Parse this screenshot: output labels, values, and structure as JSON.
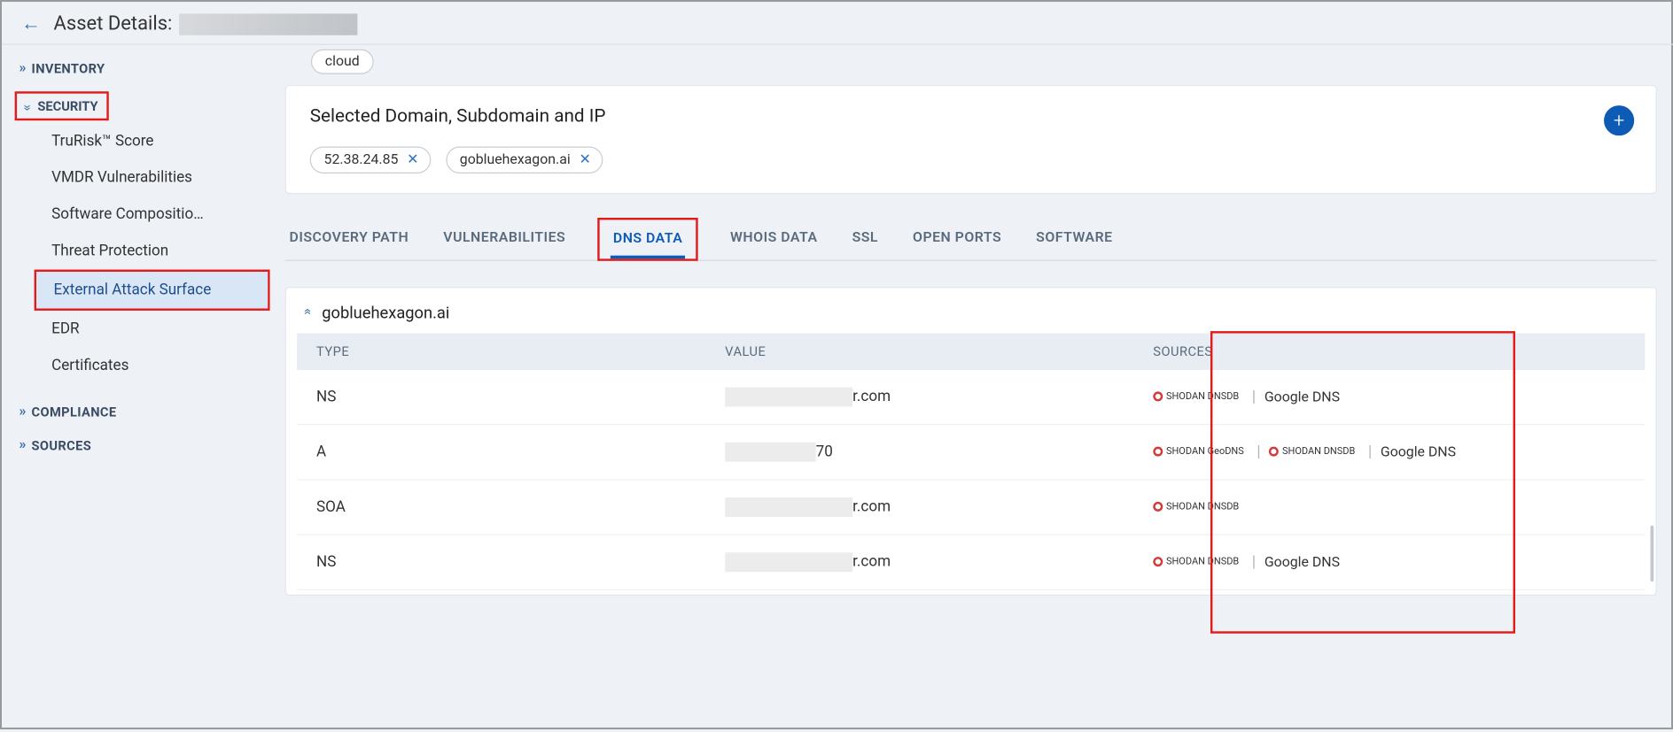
{
  "header": {
    "title_prefix": "Asset Details:"
  },
  "sidebar": {
    "sections": [
      {
        "label": "INVENTORY",
        "expanded": false
      },
      {
        "label": "SECURITY",
        "expanded": true
      },
      {
        "label": "COMPLIANCE",
        "expanded": false
      },
      {
        "label": "SOURCES",
        "expanded": false
      }
    ],
    "security_items": [
      {
        "label": "TruRisk™ Score"
      },
      {
        "label": "VMDR Vulnerabilities"
      },
      {
        "label": "Software Compositio…"
      },
      {
        "label": "Threat Protection"
      },
      {
        "label": "External Attack Surface",
        "active": true
      },
      {
        "label": "EDR"
      },
      {
        "label": "Certificates"
      }
    ]
  },
  "top_tag": "cloud",
  "panel": {
    "title": "Selected Domain, Subdomain and IP",
    "chips": [
      {
        "label": "52.38.24.85"
      },
      {
        "label": "gobluehexagon.ai"
      }
    ]
  },
  "tabs": [
    {
      "label": "DISCOVERY PATH"
    },
    {
      "label": "VULNERABILITIES"
    },
    {
      "label": "DNS DATA",
      "active": true
    },
    {
      "label": "WHOIS DATA"
    },
    {
      "label": "SSL"
    },
    {
      "label": "OPEN PORTS"
    },
    {
      "label": "SOFTWARE"
    }
  ],
  "dns": {
    "domain": "gobluehexagon.ai",
    "columns": {
      "type": "TYPE",
      "value": "VALUE",
      "sources": "SOURCES"
    },
    "rows": [
      {
        "type": "NS",
        "value_suffix": "r.com",
        "redact_w": 118,
        "sources": [
          {
            "kind": "badge",
            "text": "SHODAN DNSDB"
          },
          {
            "kind": "sep"
          },
          {
            "kind": "text",
            "text": "Google DNS"
          }
        ]
      },
      {
        "type": "A",
        "value_suffix": "70",
        "redact_w": 84,
        "sources": [
          {
            "kind": "badge",
            "text": "SHODAN GeoDNS"
          },
          {
            "kind": "sep"
          },
          {
            "kind": "badge",
            "text": "SHODAN DNSDB"
          },
          {
            "kind": "sep"
          },
          {
            "kind": "text",
            "text": "Google DNS"
          }
        ]
      },
      {
        "type": "SOA",
        "value_suffix": "r.com",
        "redact_w": 118,
        "sources": [
          {
            "kind": "badge",
            "text": "SHODAN DNSDB"
          }
        ]
      },
      {
        "type": "NS",
        "value_suffix": "r.com",
        "redact_w": 118,
        "sources": [
          {
            "kind": "badge",
            "text": "SHODAN DNSDB"
          },
          {
            "kind": "sep"
          },
          {
            "kind": "text",
            "text": "Google DNS"
          }
        ]
      }
    ]
  }
}
